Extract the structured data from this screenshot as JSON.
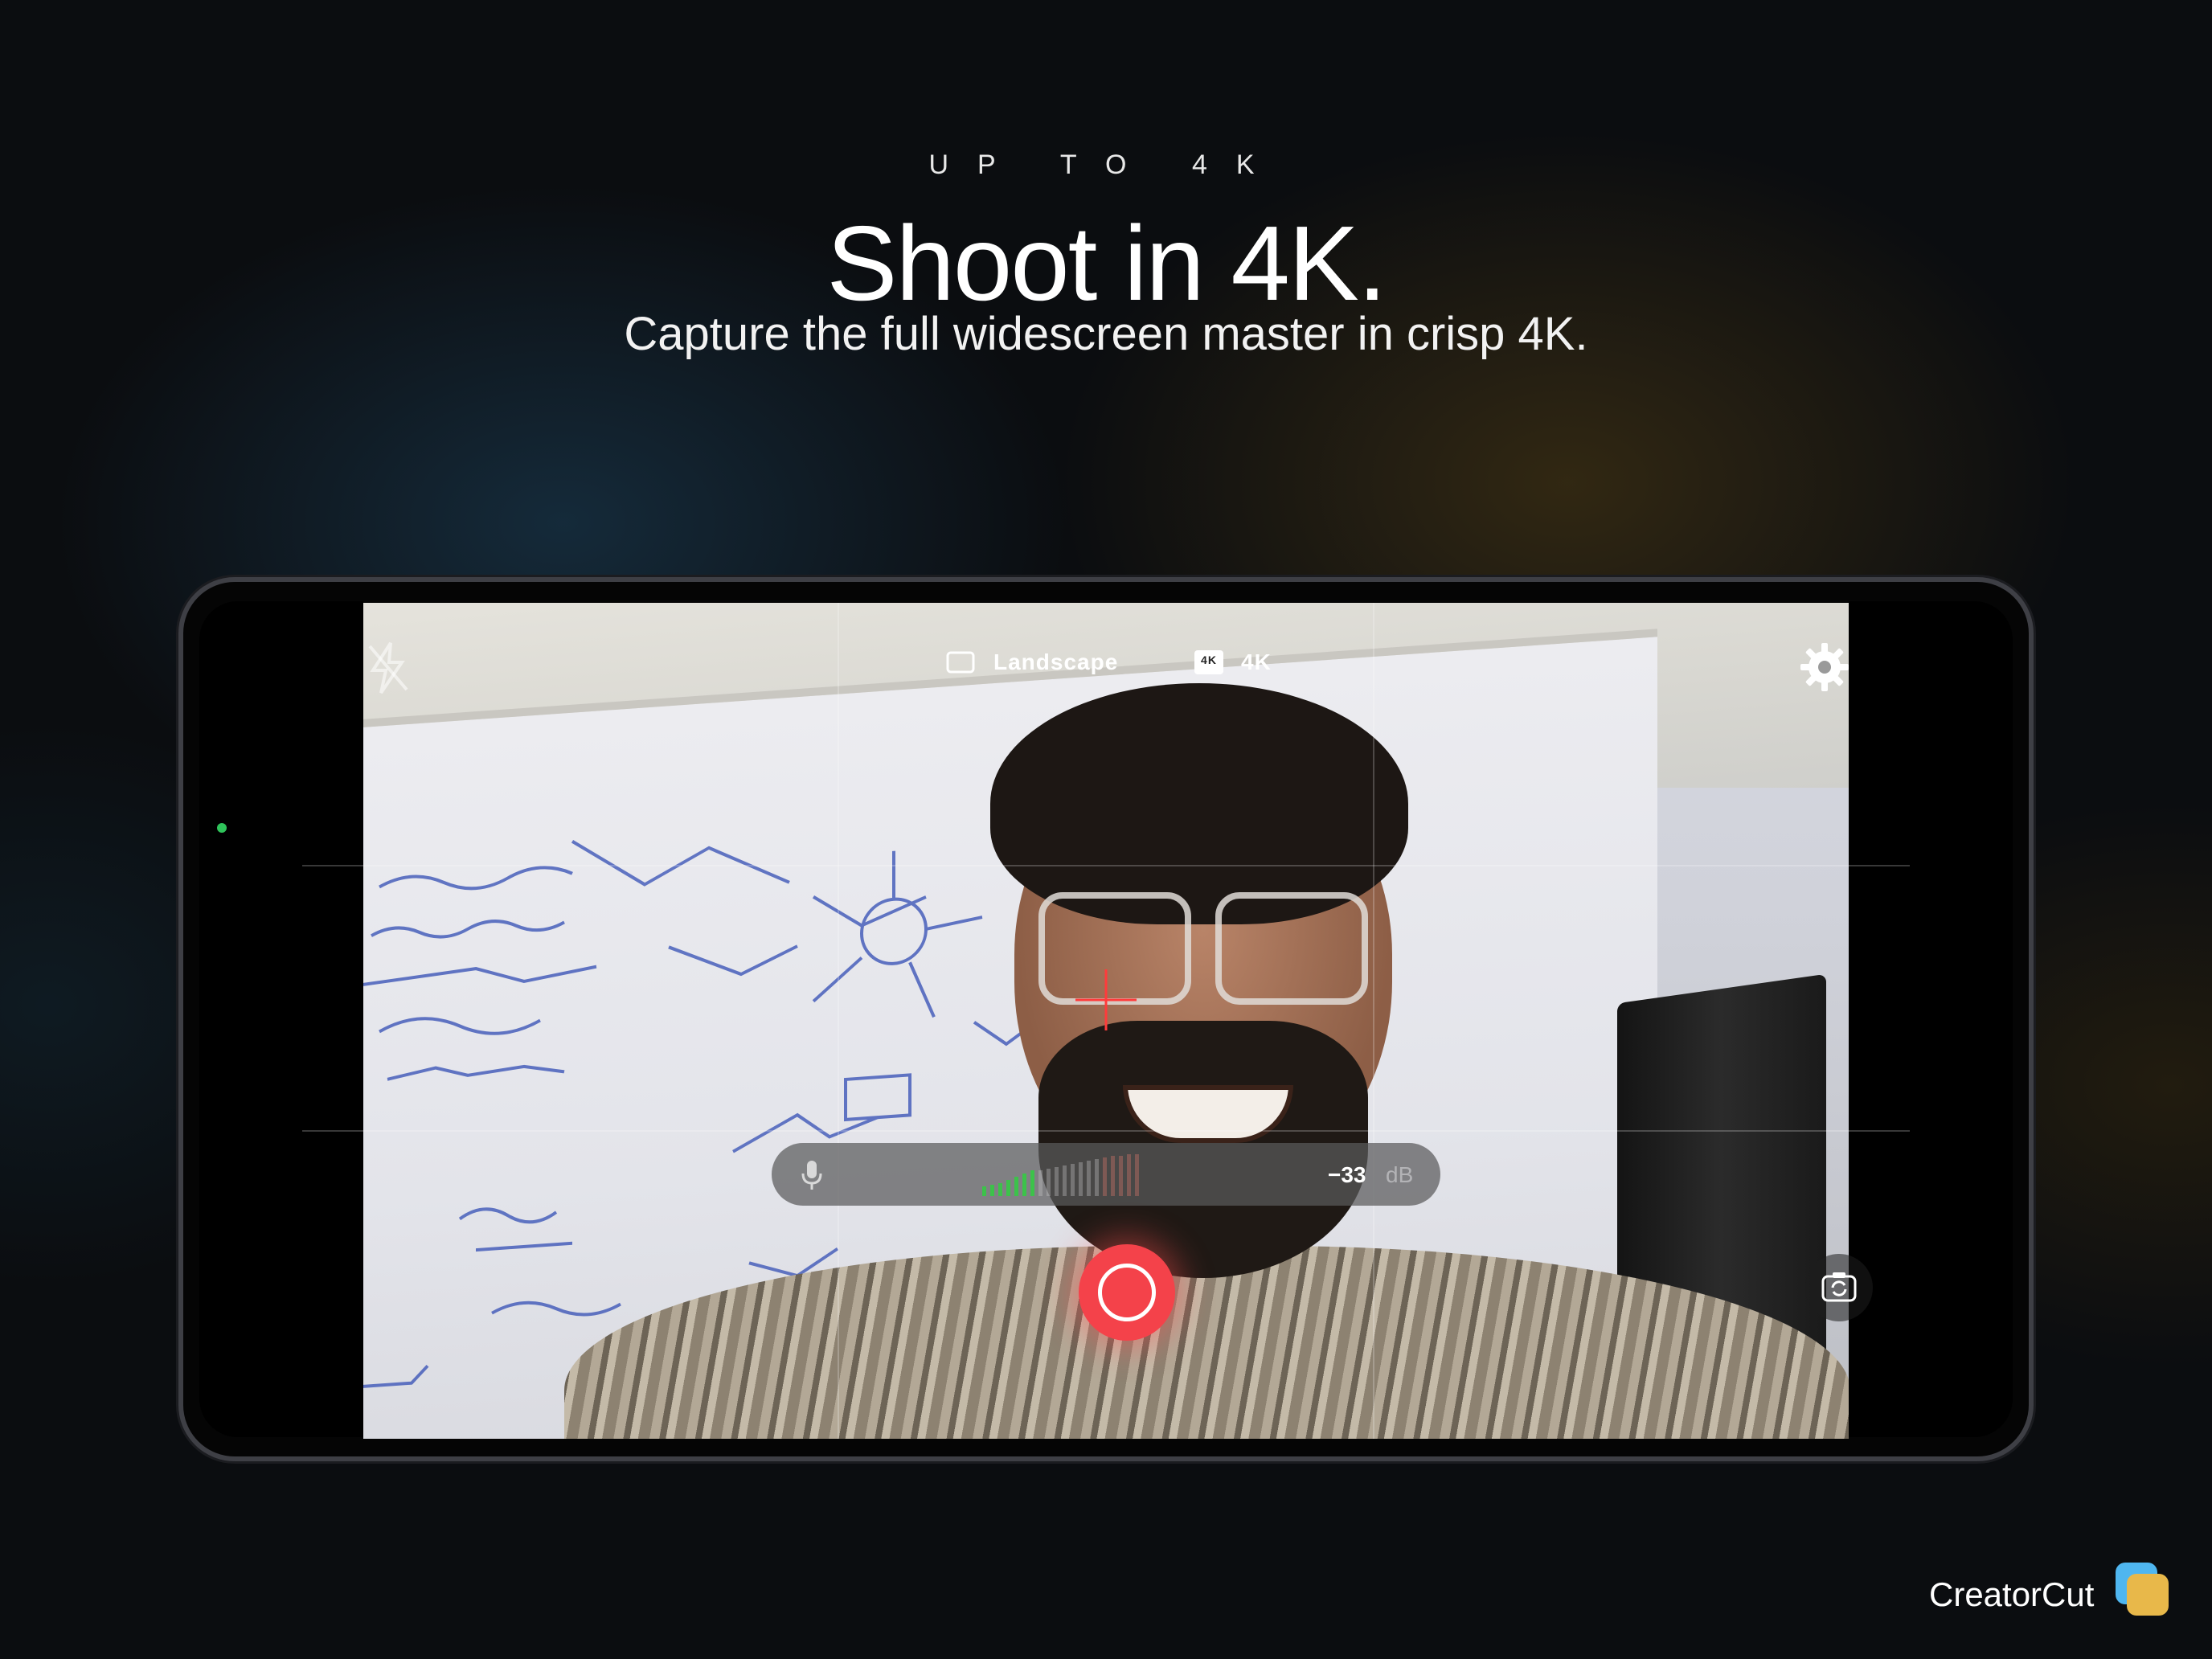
{
  "header": {
    "eyebrow": "UP TO 4K",
    "title": "Shoot in 4K.",
    "subtitle": "Capture the full widescreen master in crisp 4K."
  },
  "camera_ui": {
    "orientation_label": "Landscape",
    "resolution_badge": "4K",
    "resolution_label": "4K",
    "audio_meter": {
      "level_value": "−33",
      "unit": "dB"
    },
    "icons": {
      "flash": "flash-off-icon",
      "settings": "gear-icon",
      "mic": "microphone-icon",
      "record": "record-icon",
      "flip": "flip-camera-icon"
    },
    "status_indicator_color": "#2fc35a",
    "record_color": "#f4424a"
  },
  "brand": {
    "name": "CreatorCut",
    "icon_colors": [
      "#4fb6f0",
      "#e8b84a"
    ]
  }
}
